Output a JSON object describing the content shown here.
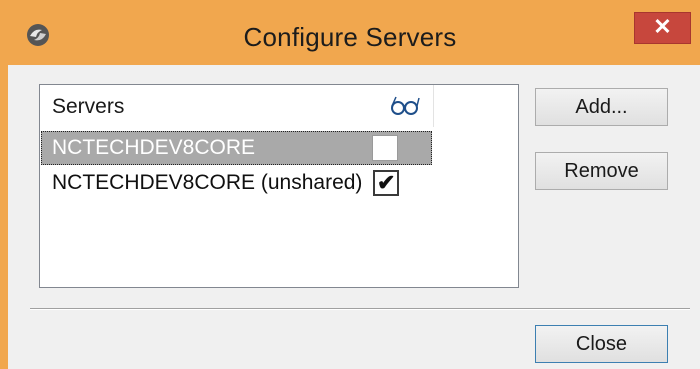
{
  "window": {
    "title": "Configure Servers",
    "close_glyph": "✕",
    "app_icon": "app-logo-icon",
    "colors": {
      "frame": "#f1a74e",
      "close_button": "#c7473d",
      "client": "#f0f0f0",
      "selection": "#a9a9a9"
    }
  },
  "server_list": {
    "column_servers": "Servers",
    "column_shared_icon": "glasses-icon",
    "rows": [
      {
        "label": "NCTECHDEV8CORE",
        "checked": false,
        "selected": true
      },
      {
        "label": "NCTECHDEV8CORE (unshared)",
        "checked": true,
        "selected": false
      }
    ],
    "check_glyph": "✔"
  },
  "buttons": {
    "add": "Add...",
    "remove": "Remove",
    "close": "Close"
  }
}
